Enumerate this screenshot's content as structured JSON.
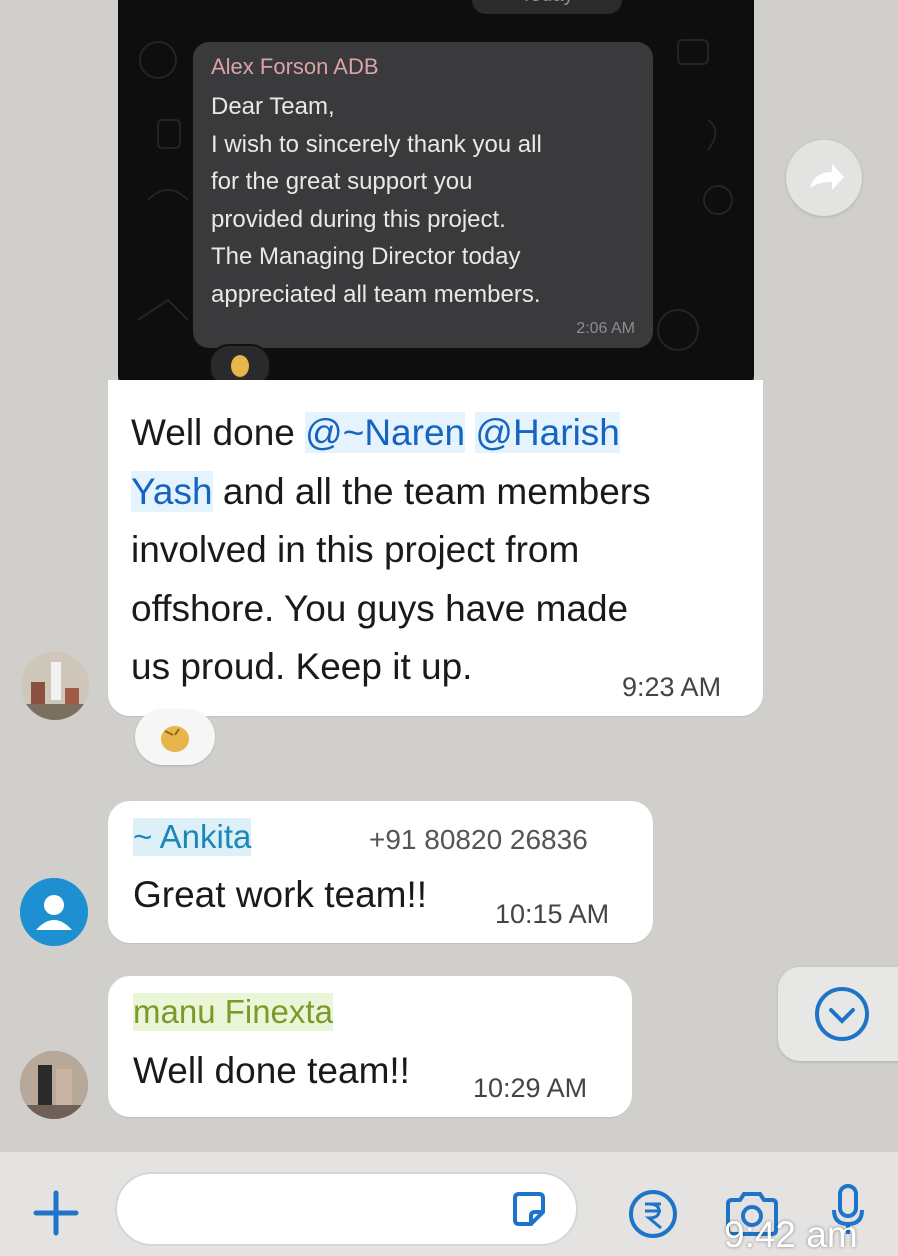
{
  "day_label": "Today",
  "quoted_message": {
    "sender": "Alex Forson ADB",
    "text": "Dear Team,\nI wish to sincerely thank you all\nfor the great support you\nprovided during this project.\nThe Managing Director today\nappreciated all team members.",
    "time": "2:06 AM"
  },
  "messages": [
    {
      "mention1": "@~Naren",
      "mention2": "@Harish",
      "mention3": "Yash",
      "line1_prefix": "Well done ",
      "line2_rest": " and all the team members",
      "line3": "involved in this project from",
      "line4": "offshore. You guys have made",
      "line5": "us proud. Keep it up.",
      "time": "9:23 AM"
    },
    {
      "sender": "~ Ankita",
      "phone": "+91 80820 26836",
      "text": "Great work team!!",
      "time": "10:15 AM"
    },
    {
      "sender": "manu Finexta",
      "text": "Well done team!!",
      "time": "10:29 AM"
    }
  ],
  "status_time": "9:42 am",
  "colors": {
    "mention": "#1565c0",
    "ankita": "#1b88b8",
    "manu": "#7a9b2a",
    "accent": "#1e74c9"
  },
  "icons": [
    "forward-icon",
    "reaction-emoji-icon",
    "chevron-down-icon",
    "plus-icon",
    "sticker-icon",
    "rupee-icon",
    "camera-icon",
    "mic-icon",
    "person-icon"
  ]
}
